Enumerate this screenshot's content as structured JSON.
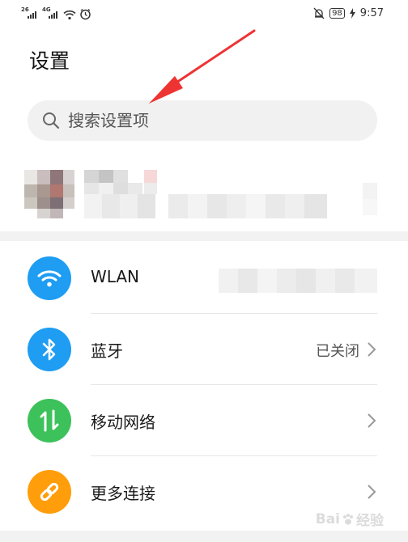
{
  "status_bar": {
    "sim1_network": "26",
    "sim2_network": "4G",
    "battery": "98",
    "time": "9:57",
    "icons": [
      "signal-icon",
      "signal-icon",
      "wifi-icon",
      "alarm-icon",
      "notification-off-icon",
      "battery-icon",
      "charging-icon"
    ]
  },
  "page": {
    "title": "设置"
  },
  "search": {
    "placeholder": "搜索设置项",
    "icon": "search-icon"
  },
  "settings": [
    {
      "label": "WLAN",
      "value": "",
      "icon": "wifi-icon",
      "color": "#1e9df2"
    },
    {
      "label": "蓝牙",
      "value": "已关闭",
      "icon": "bluetooth-icon",
      "color": "#1e9df2"
    },
    {
      "label": "移动网络",
      "value": "",
      "icon": "mobile-data-icon",
      "color": "#3cc15b"
    },
    {
      "label": "更多连接",
      "value": "",
      "icon": "link-icon",
      "color": "#ff9d0a"
    }
  ],
  "annotation": {
    "color": "#ee3333"
  },
  "watermark": {
    "text": "Bai",
    "text2": "经验"
  }
}
